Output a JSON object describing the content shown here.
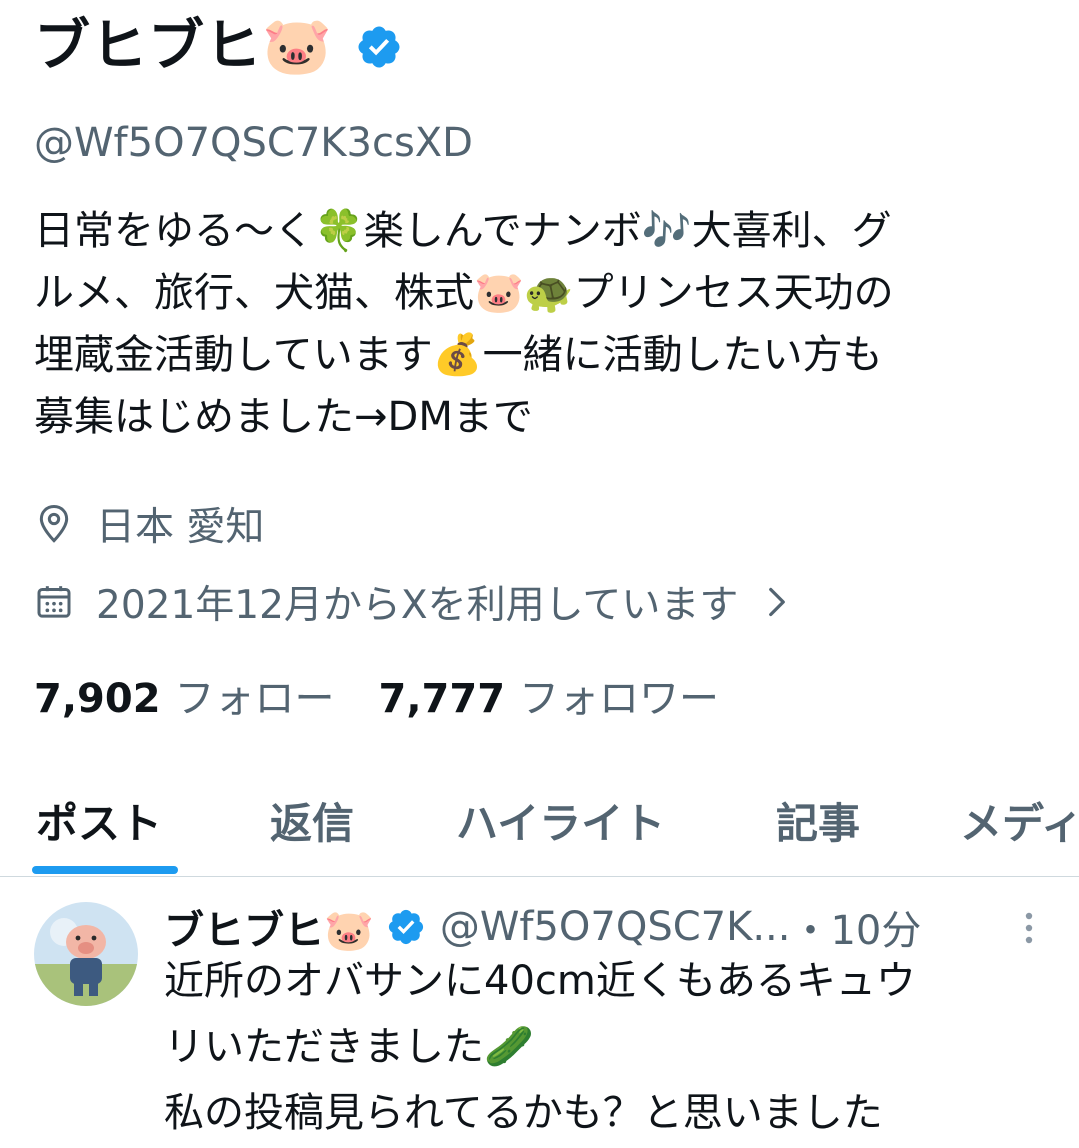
{
  "profile": {
    "display_name": "ブヒブヒ🐷",
    "verified_icon": "verified-badge-icon",
    "handle": "@Wf5O7QSC7K3csXD",
    "bio": "日常をゆる〜く🍀楽しんでナンボ🎶大喜利、グ\nルメ、旅行、犬猫、株式🐷🐢プリンセス天功の\n埋蔵金活動しています💰一緒に活動したい方も\n募集はじめました→DMまで",
    "location": "日本 愛知",
    "joined": "2021年12月からXを利用しています",
    "following_count": "7,902",
    "following_label": "フォロー",
    "followers_count": "7,777",
    "followers_label": "フォロワー"
  },
  "tabs": [
    "ポスト",
    "返信",
    "ハイライト",
    "記事",
    "メディア"
  ],
  "active_tab": "ポスト",
  "post": {
    "author_name": "ブヒブヒ🐷",
    "author_handle": "@Wf5O7QSC7K...",
    "time": "・10分",
    "text": "近所のオバサンに40cm近くもあるキュウ\nリいただきました🥒\n私の投稿見られてるかも？と思いました"
  },
  "colors": {
    "accent": "#1d9bf0",
    "muted": "#536471",
    "text": "#0f1419"
  }
}
